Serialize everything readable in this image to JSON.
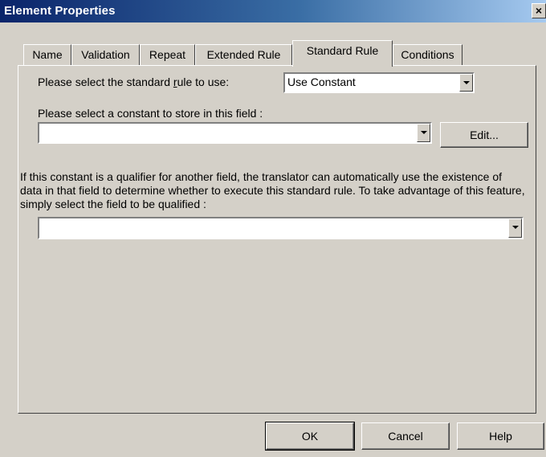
{
  "window": {
    "title": "Element Properties",
    "close_glyph": "×"
  },
  "tabs": [
    {
      "label": "Name"
    },
    {
      "label": "Validation"
    },
    {
      "label": "Repeat"
    },
    {
      "label": "Extended Rule"
    },
    {
      "label": "Standard Rule",
      "active": true
    },
    {
      "label": "Conditions"
    }
  ],
  "rule": {
    "label_pre": "Please select the standard ",
    "label_mnemonic": "r",
    "label_post": "ule to use:",
    "value": "Use Constant"
  },
  "constant": {
    "label": "Please select a constant to store in this field :",
    "value": "",
    "edit_label": "Edit..."
  },
  "qualifier": {
    "description": "If this constant is a qualifier for another field, the translator can automatically use the existence of data in that field to determine whether to execute this standard rule. To take advantage of this feature, simply select the field to be qualified :",
    "value": ""
  },
  "buttons": {
    "ok": "OK",
    "cancel": "Cancel",
    "help": "Help"
  }
}
